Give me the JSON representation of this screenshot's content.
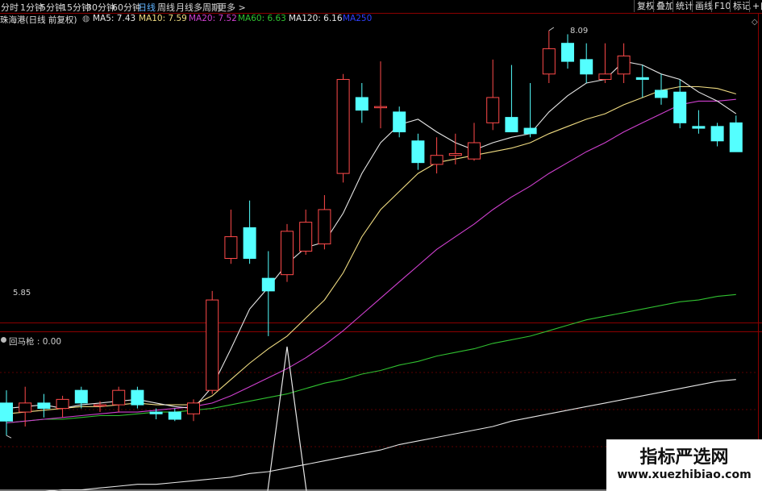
{
  "toolbar": {
    "periods": [
      "分时",
      "1分钟",
      "5分钟",
      "15分钟",
      "30分钟",
      "60分钟",
      "日线",
      "周线",
      "月线",
      "多周期",
      "更多 >"
    ],
    "active_period": "日线",
    "right_buttons": [
      "复权",
      "叠加",
      "统计",
      "画线",
      "F10",
      "标记",
      "+自"
    ]
  },
  "infobar": {
    "stock_title": "珠海港(日线 前复权)",
    "ma": [
      {
        "label": "MA5: 7.43",
        "color": "#e6e6e6"
      },
      {
        "label": "MA10: 7.59",
        "color": "#f0dc82"
      },
      {
        "label": "MA20: 7.52",
        "color": "#d040d0"
      },
      {
        "label": "MA60: 6.63",
        "color": "#30c030"
      },
      {
        "label": "MA120: 6.16",
        "color": "#e6e6e6"
      },
      {
        "label": "MA250",
        "color": "#3040ff"
      }
    ]
  },
  "price_annotations": {
    "high": "8.09",
    "low": "5.85"
  },
  "indicator": {
    "label": "回马枪 : 0.00"
  },
  "watermark": {
    "line1": "指标严选网",
    "line2": "www.xuezhibiao.com"
  },
  "colors": {
    "up": "#ff4a4a",
    "down": "#54ffff",
    "ma5": "#e6e6e6",
    "ma10": "#f0dc82",
    "ma20": "#d040d0",
    "ma60": "#30c030",
    "ma120": "#e6e6e6",
    "grid": "#8b0000"
  },
  "chart_data": {
    "type": "candlestick",
    "candles": [
      {
        "o": 6.03,
        "h": 6.1,
        "l": 5.85,
        "c": 5.93
      },
      {
        "o": 5.98,
        "h": 6.12,
        "l": 5.9,
        "c": 6.03
      },
      {
        "o": 6.03,
        "h": 6.08,
        "l": 5.95,
        "c": 6.0
      },
      {
        "o": 6.0,
        "h": 6.07,
        "l": 5.95,
        "c": 6.05
      },
      {
        "o": 6.1,
        "h": 6.12,
        "l": 6.0,
        "c": 6.03
      },
      {
        "o": 6.02,
        "h": 6.04,
        "l": 5.98,
        "c": 6.02
      },
      {
        "o": 6.02,
        "h": 6.12,
        "l": 5.98,
        "c": 6.1
      },
      {
        "o": 6.1,
        "h": 6.12,
        "l": 6.0,
        "c": 6.02
      },
      {
        "o": 5.98,
        "h": 6.0,
        "l": 5.94,
        "c": 5.97
      },
      {
        "o": 5.98,
        "h": 6.0,
        "l": 5.93,
        "c": 5.94
      },
      {
        "o": 5.97,
        "h": 6.05,
        "l": 5.93,
        "c": 6.03
      },
      {
        "o": 6.1,
        "h": 6.65,
        "l": 6.08,
        "c": 6.6
      },
      {
        "o": 6.83,
        "h": 7.1,
        "l": 6.8,
        "c": 6.95
      },
      {
        "o": 7.0,
        "h": 7.15,
        "l": 6.8,
        "c": 6.83
      },
      {
        "o": 6.72,
        "h": 6.87,
        "l": 6.4,
        "c": 6.65
      },
      {
        "o": 6.74,
        "h": 7.02,
        "l": 6.7,
        "c": 6.98
      },
      {
        "o": 6.87,
        "h": 7.1,
        "l": 6.85,
        "c": 7.03
      },
      {
        "o": 6.91,
        "h": 7.18,
        "l": 6.88,
        "c": 7.1
      },
      {
        "o": 7.3,
        "h": 7.85,
        "l": 7.25,
        "c": 7.82
      },
      {
        "o": 7.72,
        "h": 7.8,
        "l": 7.58,
        "c": 7.65
      },
      {
        "o": 7.67,
        "h": 7.92,
        "l": 7.55,
        "c": 7.67
      },
      {
        "o": 7.64,
        "h": 7.67,
        "l": 7.5,
        "c": 7.53
      },
      {
        "o": 7.48,
        "h": 7.52,
        "l": 7.32,
        "c": 7.36
      },
      {
        "o": 7.35,
        "h": 7.5,
        "l": 7.3,
        "c": 7.4
      },
      {
        "o": 7.4,
        "h": 7.52,
        "l": 7.35,
        "c": 7.41
      },
      {
        "o": 7.38,
        "h": 7.58,
        "l": 7.37,
        "c": 7.47
      },
      {
        "o": 7.58,
        "h": 7.93,
        "l": 7.54,
        "c": 7.72
      },
      {
        "o": 7.61,
        "h": 7.9,
        "l": 7.55,
        "c": 7.53
      },
      {
        "o": 7.55,
        "h": 7.8,
        "l": 7.5,
        "c": 7.52
      },
      {
        "o": 7.85,
        "h": 8.09,
        "l": 7.8,
        "c": 7.99
      },
      {
        "o": 8.02,
        "h": 8.07,
        "l": 7.88,
        "c": 7.92
      },
      {
        "o": 7.93,
        "h": 8.02,
        "l": 7.8,
        "c": 7.85
      },
      {
        "o": 7.82,
        "h": 8.02,
        "l": 7.8,
        "c": 7.85
      },
      {
        "o": 7.85,
        "h": 8.02,
        "l": 7.8,
        "c": 7.95
      },
      {
        "o": 7.83,
        "h": 7.9,
        "l": 7.72,
        "c": 7.82
      },
      {
        "o": 7.76,
        "h": 7.85,
        "l": 7.68,
        "c": 7.72
      },
      {
        "o": 7.75,
        "h": 7.82,
        "l": 7.55,
        "c": 7.58
      },
      {
        "o": 7.56,
        "h": 7.65,
        "l": 7.52,
        "c": 7.55
      },
      {
        "o": 7.56,
        "h": 7.58,
        "l": 7.45,
        "c": 7.48
      },
      {
        "o": 7.58,
        "h": 7.62,
        "l": 7.42,
        "c": 7.42
      }
    ],
    "ma5": [
      6.0,
      6.01,
      6.02,
      6.0,
      6.02,
      6.03,
      6.04,
      6.05,
      6.03,
      6.01,
      6.0,
      6.12,
      6.33,
      6.55,
      6.67,
      6.8,
      6.89,
      6.92,
      7.08,
      7.3,
      7.47,
      7.57,
      7.6,
      7.53,
      7.47,
      7.43,
      7.47,
      7.5,
      7.52,
      7.64,
      7.73,
      7.8,
      7.82,
      7.92,
      7.9,
      7.85,
      7.82,
      7.75,
      7.7,
      7.63
    ],
    "ma10": [
      5.97,
      5.98,
      5.99,
      6.0,
      6.01,
      6.01,
      6.02,
      6.03,
      6.02,
      6.02,
      6.02,
      6.07,
      6.16,
      6.25,
      6.33,
      6.4,
      6.5,
      6.6,
      6.75,
      6.95,
      7.1,
      7.2,
      7.3,
      7.36,
      7.38,
      7.4,
      7.42,
      7.44,
      7.47,
      7.52,
      7.56,
      7.6,
      7.63,
      7.68,
      7.72,
      7.76,
      7.78,
      7.78,
      7.77,
      7.74
    ],
    "ma20": [
      5.92,
      5.93,
      5.94,
      5.95,
      5.96,
      5.97,
      5.98,
      5.98,
      5.99,
      6.0,
      6.01,
      6.03,
      6.07,
      6.12,
      6.17,
      6.22,
      6.28,
      6.35,
      6.43,
      6.52,
      6.61,
      6.7,
      6.79,
      6.88,
      6.95,
      7.02,
      7.1,
      7.17,
      7.23,
      7.3,
      7.36,
      7.42,
      7.47,
      7.53,
      7.58,
      7.63,
      7.68,
      7.7,
      7.7,
      7.71
    ],
    "ma60": [
      5.92,
      5.93,
      5.94,
      5.94,
      5.95,
      5.96,
      5.96,
      5.97,
      5.98,
      5.98,
      5.99,
      6.0,
      6.02,
      6.04,
      6.06,
      6.08,
      6.11,
      6.14,
      6.16,
      6.19,
      6.21,
      6.24,
      6.26,
      6.29,
      6.31,
      6.33,
      6.36,
      6.38,
      6.4,
      6.43,
      6.46,
      6.49,
      6.51,
      6.53,
      6.55,
      6.57,
      6.59,
      6.6,
      6.62,
      6.63
    ],
    "ma120": [
      5.52,
      5.53,
      5.54,
      5.55,
      5.55,
      5.56,
      5.57,
      5.58,
      5.58,
      5.59,
      5.6,
      5.61,
      5.62,
      5.64,
      5.65,
      5.67,
      5.69,
      5.71,
      5.73,
      5.75,
      5.77,
      5.8,
      5.82,
      5.84,
      5.86,
      5.88,
      5.9,
      5.93,
      5.95,
      5.97,
      5.99,
      6.01,
      6.03,
      6.05,
      6.07,
      6.09,
      6.11,
      6.13,
      6.15,
      6.16
    ],
    "indicator_values": [
      0,
      0,
      0,
      0,
      0,
      0,
      0,
      0,
      0,
      0,
      0,
      0,
      0,
      0,
      0,
      1,
      0,
      0,
      0,
      0,
      0,
      0,
      0,
      0,
      0,
      0,
      0,
      0,
      0,
      0,
      0,
      0,
      0,
      0,
      0,
      0,
      0,
      0,
      0,
      0
    ]
  }
}
